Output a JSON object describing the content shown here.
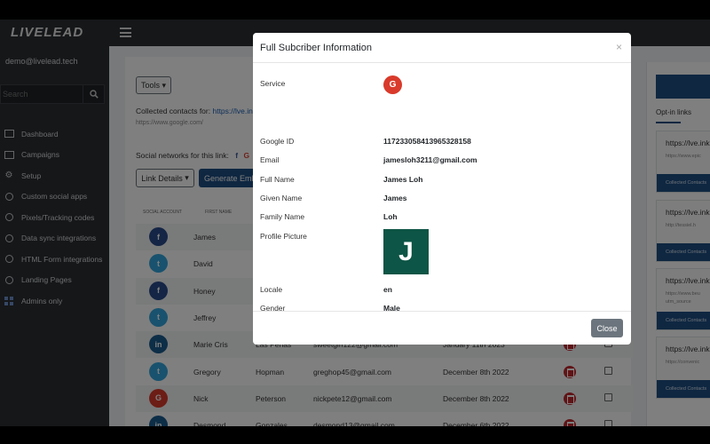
{
  "app": {
    "logo_text": "LIVELEAD"
  },
  "sidebar": {
    "user_email": "demo@livelead.tech",
    "search_placeholder": "Search",
    "items": [
      {
        "label": "Dashboard",
        "icon": "dashboard-icon"
      },
      {
        "label": "Campaigns",
        "icon": "campaigns-icon"
      },
      {
        "label": "Setup",
        "icon": "gear-icon"
      },
      {
        "label": "Custom social apps",
        "icon": "circle-icon"
      },
      {
        "label": "Pixels/Tracking codes",
        "icon": "circle-icon"
      },
      {
        "label": "Data sync integrations",
        "icon": "circle-icon"
      },
      {
        "label": "HTML Form integrations",
        "icon": "circle-icon"
      },
      {
        "label": "Landing Pages",
        "icon": "circle-icon"
      },
      {
        "label": "Admins only",
        "icon": "grid-icon"
      }
    ]
  },
  "main": {
    "tools_label": "Tools",
    "collected_prefix": "Collected contacts for:",
    "collected_link": "https://lve.ink",
    "collected_sub": "https://www.google.com/",
    "social_label": "Social networks for this link:",
    "link_details_label": "Link Details",
    "generate_label": "Generate Emb",
    "headers": {
      "social": "SOCIAL ACCOUNT",
      "first": "FIRST NAME"
    },
    "rows": [
      {
        "network": "f",
        "first": "James",
        "last": "",
        "email": "",
        "date": ""
      },
      {
        "network": "t",
        "first": "David",
        "last": "",
        "email": "",
        "date": ""
      },
      {
        "network": "f",
        "first": "Honey",
        "last": "",
        "email": "",
        "date": ""
      },
      {
        "network": "t",
        "first": "Jeffrey",
        "last": "",
        "email": "",
        "date": ""
      },
      {
        "network": "in",
        "first": "Marie Cris",
        "last": "Las Penas",
        "email": "sweetgirl122@gmail.com",
        "date": "January 11th 2023"
      },
      {
        "network": "t",
        "first": "Gregory",
        "last": "Hopman",
        "email": "greghop45@gmail.com",
        "date": "December 8th 2022"
      },
      {
        "network": "G",
        "first": "Nick",
        "last": "Peterson",
        "email": "nickpete12@gmail.com",
        "date": "December 8th 2022"
      },
      {
        "network": "in",
        "first": "Desmond",
        "last": "Gonzales",
        "email": "desmond13@gmail.com",
        "date": "December 6th 2022"
      }
    ]
  },
  "right_panel": {
    "title": "Opt-in links",
    "cards": [
      {
        "url": "https://lve.ink",
        "sub": "https://www.epic",
        "button": "Collected Contacts"
      },
      {
        "url": "https://lve.ink",
        "sub": "http://tessiel.h",
        "button": "Collected Contacts"
      },
      {
        "url": "https://lve.ink",
        "sub": "https://www.beu",
        "sub2": "utm_source",
        "button": "Collected Contacts"
      },
      {
        "url": "https://lve.ink",
        "sub": "https://convenic",
        "button": "Collected Contacts"
      }
    ]
  },
  "modal": {
    "title": "Full Subcriber Information",
    "close_symbol": "×",
    "fields": {
      "service_label": "Service",
      "service_badge": "G",
      "google_id_label": "Google ID",
      "google_id": "117233058413965328158",
      "email_label": "Email",
      "email": "jamesloh3211@gmail.com",
      "full_name_label": "Full Name",
      "full_name": "James Loh",
      "given_name_label": "Given Name",
      "given_name": "James",
      "family_name_label": "Family Name",
      "family_name": "Loh",
      "profile_picture_label": "Profile Picture",
      "profile_initial": "J",
      "locale_label": "Locale",
      "locale": "en",
      "gender_label": "Gender",
      "gender": "Male"
    },
    "close_button": "Close"
  },
  "colors": {
    "sidebar_bg": "#2b2f33",
    "primary": "#1f4f82",
    "google_red": "#d93a2b",
    "avatar_green": "#0d5546"
  }
}
